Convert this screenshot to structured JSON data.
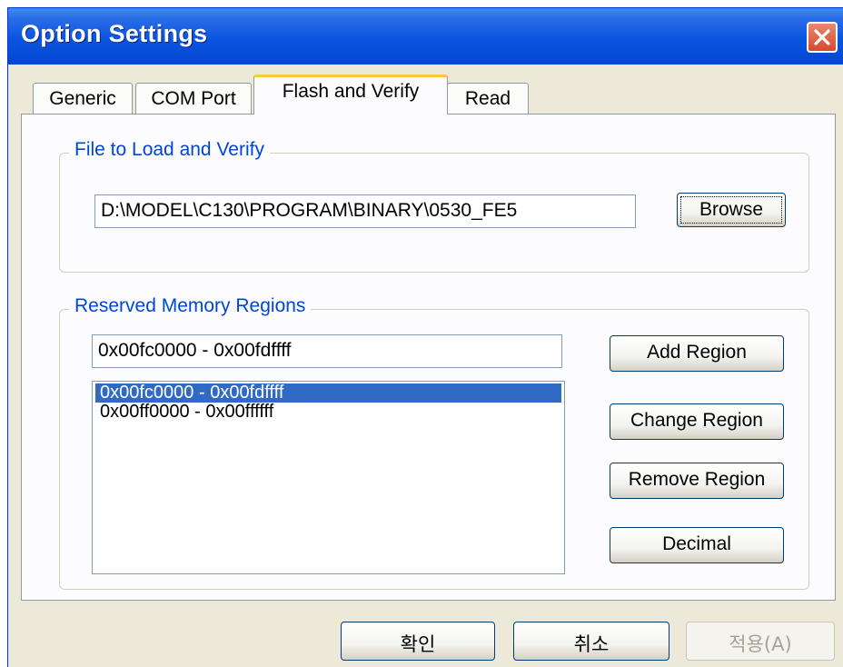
{
  "window": {
    "title": "Option Settings",
    "close_icon": "close-icon",
    "close_color": "#d5492f"
  },
  "tabs": [
    {
      "label": "Generic",
      "active": false
    },
    {
      "label": "COM Port",
      "active": false
    },
    {
      "label": "Flash and Verify",
      "active": true
    },
    {
      "label": "Read",
      "active": false
    }
  ],
  "file_group": {
    "legend": "File to Load and Verify",
    "path_value": "D:\\MODEL\\C130\\PROGRAM\\BINARY\\0530_FE5",
    "browse_label": "Browse"
  },
  "memory_group": {
    "legend": "Reserved Memory Regions",
    "region_input_value": "0x00fc0000 - 0x00fdffff",
    "regions": [
      {
        "label": "0x00fc0000 - 0x00fdffff",
        "selected": true
      },
      {
        "label": "0x00ff0000 - 0x00ffffff",
        "selected": false
      }
    ],
    "add_label": "Add Region",
    "change_label": "Change Region",
    "remove_label": "Remove Region",
    "decimal_label": "Decimal"
  },
  "footer": {
    "ok_label": "확인",
    "cancel_label": "취소",
    "apply_label": "적용(A)"
  },
  "colors": {
    "titlebar": "#0a55e0",
    "legend_text": "#0046d5",
    "selection": "#316ac5",
    "active_tab_accent": "#ffc73c"
  }
}
